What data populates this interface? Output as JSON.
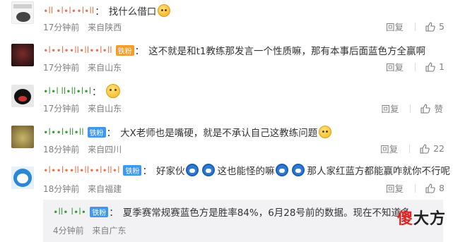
{
  "comments": [
    {
      "username": "∙ll ∙l∙l∙∙l∙ll",
      "badge": "",
      "text": "找什么借口",
      "emoji": "cool-face-emoji",
      "time": "17分钟前",
      "location": "来自陕西",
      "reply_label": "回复",
      "likes": "5"
    },
    {
      "username": "∙l∙∙l∙∙ll∙ll∙∙l∙ll",
      "badge": "铁粉",
      "text": "这不就是和t1教练那发言一个性质嘛，那有本事后面蓝色方全赢啊",
      "emoji": "",
      "time": "17分钟前",
      "location": "来自山东",
      "reply_label": "回复",
      "likes": "1"
    },
    {
      "username": "∙l∙l ll∙ll∙l∙l",
      "badge": "",
      "text": "",
      "emoji": "thinking-face-emoji",
      "time": "17分钟前",
      "location": "来自山东",
      "reply_label": "回复",
      "likes": "赞"
    },
    {
      "username": "∙l∙∙l∙ll∙ll",
      "badge": "铁粉",
      "text": "大X老师也是嘴硬，就是不承认自己这教练问题",
      "emoji": "smirk-face-emoji",
      "time": "18分钟前",
      "location": "来自四川",
      "reply_label": "回复",
      "likes": "22"
    },
    {
      "username": "∙l∙∙l∙∙ll∙ll∙∙l∙ll∙l",
      "badge": "铁粉",
      "text_parts": [
        "好家伙",
        "这也能怪的嘛",
        "那人家红蓝方都能赢咋就你不行呢"
      ],
      "time": "18分钟前",
      "location": "来自福建",
      "reply_label": "回复",
      "likes": "8"
    }
  ],
  "sub_reply": {
    "username": "∙ll∙ l∙l∙",
    "badge": "铁粉",
    "text": "夏季赛常规赛蓝色方是胜率84%，6月28号前的数据。现在不知道多",
    "time": "4分钟前",
    "location": "来自广东"
  },
  "watermark": {
    "part_a": "傻",
    "part_b": "大方"
  },
  "colors": {
    "username": "#eb7350",
    "badge_blue": "#3e98ef",
    "badge_orange": "#f39d2b",
    "meta": "#808080"
  }
}
